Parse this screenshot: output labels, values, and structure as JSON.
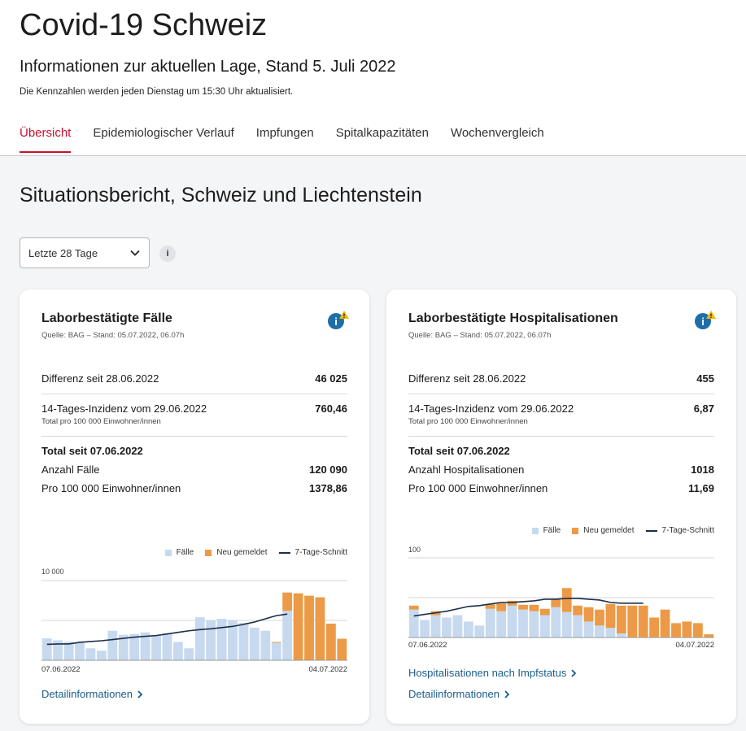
{
  "header": {
    "title": "Covid-19 Schweiz",
    "subtitle": "Informationen zur aktuellen Lage, Stand 5. Juli 2022",
    "update_note": "Die Kennzahlen werden jeden Dienstag um 15:30 Uhr aktualisiert."
  },
  "tabs": [
    {
      "label": "Übersicht",
      "active": true
    },
    {
      "label": "Epidemiologischer Verlauf",
      "active": false
    },
    {
      "label": "Impfungen",
      "active": false
    },
    {
      "label": "Spitalkapazitäten",
      "active": false
    },
    {
      "label": "Wochenvergleich",
      "active": false
    }
  ],
  "main": {
    "section_title": "Situationsbericht, Schweiz und Liechtenstein",
    "range_select": {
      "value": "Letzte 28 Tage"
    },
    "info_label": "i"
  },
  "colors": {
    "accent": "#c8102e",
    "bar_cases": "#c6d9ee",
    "bar_new": "#ec9a47",
    "line": "#1c2d4a",
    "link": "#1a5d8a",
    "info_blue": "#1e6fa8",
    "warning": "#f5b700"
  },
  "icons": [
    "chevron-down-icon",
    "info-icon",
    "warning-icon",
    "chevron-right-icon"
  ],
  "cards": [
    {
      "title": "Laborbestätigte Fälle",
      "source": "Quelle: BAG – Stand: 05.07.2022, 06.07h",
      "diff_label": "Differenz seit 28.06.2022",
      "diff_value": "46 025",
      "incidence_label": "14-Tages-Inzidenz vom 29.06.2022",
      "incidence_sub": "Total pro 100 000 Einwohner/innen",
      "incidence_value": "760,46",
      "total_head": "Total seit 07.06.2022",
      "count_label": "Anzahl Fälle",
      "count_value": "120 090",
      "per100k_label": "Pro 100 000 Einwohner/innen",
      "per100k_value": "1378,86",
      "legend": {
        "cases": "Fälle",
        "new": "Neu gemeldet",
        "avg": "7-Tage-Schnitt"
      },
      "links": [
        "Detailinformationen"
      ]
    },
    {
      "title": "Laborbestätigte Hospitalisationen",
      "source": "Quelle: BAG – Stand: 05.07.2022, 06.07h",
      "diff_label": "Differenz seit 28.06.2022",
      "diff_value": "455",
      "incidence_label": "14-Tages-Inzidenz vom 29.06.2022",
      "incidence_sub": "Total pro 100 000 Einwohner/innen",
      "incidence_value": "6,87",
      "total_head": "Total seit 07.06.2022",
      "count_label": "Anzahl Hospitalisationen",
      "count_value": "1018",
      "per100k_label": "Pro 100 000 Einwohner/innen",
      "per100k_value": "11,69",
      "legend": {
        "cases": "Fälle",
        "new": "Neu gemeldet",
        "avg": "7-Tage-Schnitt"
      },
      "links": [
        "Hospitalisationen nach Impfstatus",
        "Detailinformationen"
      ]
    }
  ],
  "chart_data": [
    {
      "type": "bar",
      "ytick": "10 000",
      "ymax": 10000,
      "x_start": "07.06.2022",
      "x_end": "04.07.2022",
      "series": [
        {
          "name": "Fälle",
          "values": [
            2750,
            2500,
            2300,
            2200,
            1500,
            1200,
            3700,
            3200,
            3300,
            3500,
            3200,
            3400,
            2300,
            1500,
            5400,
            5000,
            5200,
            5000,
            4700,
            4100,
            3700,
            2200,
            6200,
            0,
            0,
            0,
            0,
            0
          ]
        },
        {
          "name": "Neu gemeldet",
          "values": [
            0,
            0,
            0,
            0,
            0,
            0,
            0,
            0,
            0,
            0,
            0,
            0,
            0,
            0,
            0,
            0,
            0,
            0,
            0,
            0,
            0,
            100,
            2300,
            8400,
            8100,
            7900,
            4600,
            2700
          ]
        },
        {
          "name": "7-Tage-Schnitt",
          "values": [
            2000,
            2050,
            2050,
            2250,
            2350,
            2450,
            2600,
            2750,
            2900,
            3000,
            3100,
            3300,
            3500,
            3700,
            3850,
            3950,
            4100,
            4250,
            4500,
            4800,
            5200,
            5600,
            5800,
            null,
            null,
            null,
            null,
            null
          ]
        }
      ]
    },
    {
      "type": "bar",
      "ytick": "100",
      "ymax": 100,
      "x_start": "07.06.2022",
      "x_end": "04.07.2022",
      "series": [
        {
          "name": "Fälle",
          "values": [
            35,
            22,
            28,
            25,
            28,
            20,
            15,
            36,
            33,
            40,
            35,
            33,
            28,
            38,
            32,
            28,
            20,
            15,
            12,
            5,
            0,
            0,
            0,
            0,
            0,
            0,
            0,
            0
          ]
        },
        {
          "name": "Neu gemeldet",
          "values": [
            5,
            0,
            5,
            0,
            0,
            0,
            0,
            6,
            10,
            6,
            6,
            8,
            8,
            10,
            30,
            12,
            18,
            20,
            30,
            35,
            40,
            40,
            25,
            35,
            18,
            20,
            18,
            4
          ]
        },
        {
          "name": "7-Tage-Schnitt",
          "values": [
            27,
            29,
            31,
            33,
            36,
            39,
            40,
            42,
            44,
            44,
            45,
            46,
            48,
            48,
            49,
            49,
            48,
            47,
            44,
            43,
            43,
            43,
            null,
            null,
            null,
            null,
            null,
            null
          ]
        }
      ]
    }
  ]
}
